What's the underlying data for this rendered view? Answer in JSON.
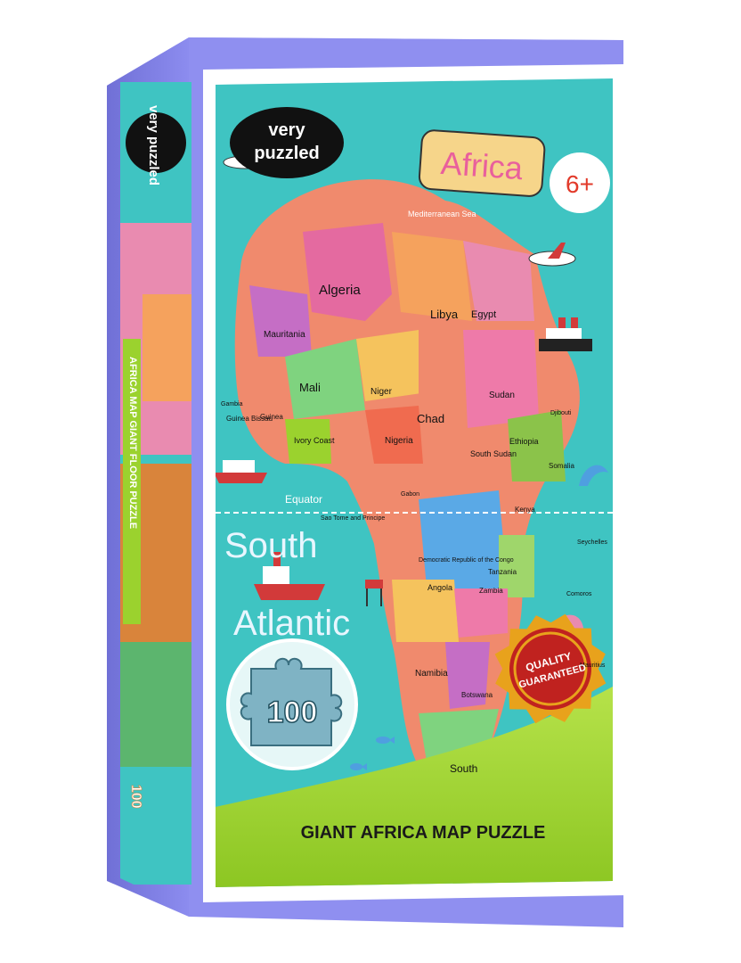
{
  "brand": {
    "line1": "very",
    "line2": "puzzled"
  },
  "title_sign": "Africa",
  "age_badge": "6+",
  "quality_seal": {
    "line1": "QUALITY",
    "line2": "GUARANTEED"
  },
  "piece_count": "100",
  "bottom_banner": "GIANT AFRICA MAP PUZZLE",
  "side_panel": {
    "title": "AFRICA MAP GIANT FLOOR PUZZLE",
    "piece_count": "100",
    "brand": "very puzzled"
  },
  "map": {
    "ocean_labels": [
      "South",
      "Atlantic"
    ],
    "sea_label": "Mediterranean Sea",
    "equator_label": "Equator",
    "countries": [
      "Algeria",
      "Libya",
      "Egypt",
      "Mauritania",
      "Mali",
      "Niger",
      "Chad",
      "Sudan",
      "Ethiopia",
      "Somalia",
      "South Sudan",
      "Nigeria",
      "Ivory Coast",
      "Guinea",
      "Guinea Bissau",
      "Gambia",
      "Sao Tome and Principe",
      "Gabon",
      "Kenya",
      "Democratic Republic of the Congo",
      "Tanzania",
      "Angola",
      "Zambia",
      "Namibia",
      "Botswana",
      "Djibouti",
      "Seychelles",
      "Comoros",
      "Mauritius",
      "South"
    ]
  },
  "colors": {
    "box_purple": "#8f8ff0",
    "box_purple_dark": "#6f6fd8",
    "ocean": "#3fc4c2",
    "border_white": "#ffffff",
    "banner_green": "#9bd22e",
    "sign_yellow": "#f6d58a",
    "seal_red": "#c0221f",
    "seal_gold": "#e8a21c"
  },
  "icons": [
    "airplane-icon",
    "ship-icon",
    "dolphin-icon",
    "puzzle-piece-icon",
    "fish-icon",
    "oil-rig-icon"
  ]
}
